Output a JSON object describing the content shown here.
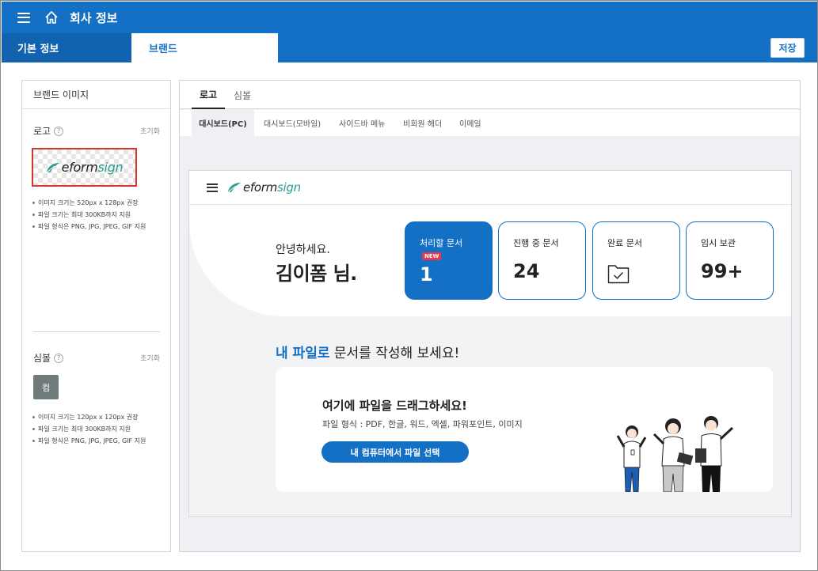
{
  "header": {
    "title": "회사 정보"
  },
  "tabs": {
    "basic": "기본 정보",
    "brand": "브랜드"
  },
  "toolbar": {
    "save_label": "저장"
  },
  "brand_image": {
    "panel_title": "브랜드 이미지",
    "logo": {
      "title": "로고",
      "reset": "초기화",
      "notes": [
        "이미지 크기는 520px x 128px 권장",
        "파일 크기는 최대 300KB까지 지원",
        "파일 형식은 PNG, JPG, JPEG, GIF 지원"
      ]
    },
    "symbol": {
      "title": "심볼",
      "reset": "초기화",
      "placeholder_char": "컴",
      "notes": [
        "이미지 크기는 120px x 120px 권장",
        "파일 크기는 최대 300KB까지 지원",
        "파일 형식은 PNG, JPG, JPEG, GIF 지원"
      ]
    }
  },
  "preview_tabs": {
    "logo": "로고",
    "symbol": "심볼"
  },
  "preview_subtabs": [
    "대시보드(PC)",
    "대시보드(모바일)",
    "사이드바 메뉴",
    "비회원 헤더",
    "이메일"
  ],
  "logo_brand": {
    "prefix": "eform",
    "suffix": "sign"
  },
  "dashboard": {
    "greeting": "안녕하세요.",
    "user": "김이폼 님.",
    "cards": [
      {
        "label": "처리할 문서",
        "badge": "NEW",
        "value": "1"
      },
      {
        "label": "진행 중 문서",
        "value": "24"
      },
      {
        "label": "완료 문서",
        "icon": "folder-check-icon"
      },
      {
        "label": "임시 보관",
        "value": "99+"
      }
    ],
    "upload_title_highlight": "내 파일로",
    "upload_title_rest": " 문서를 작성해 보세요!",
    "dropzone": {
      "title": "여기에 파일을 드래그하세요!",
      "subtitle": "파일 형식 : PDF, 한글, 워드, 엑셀, 파워포인트, 이미지",
      "button": "내 컴퓨터에서 파일 선택"
    }
  },
  "colors": {
    "primary": "#1470c4",
    "badge": "#e8384f",
    "logo_accent": "#2a9d8f"
  }
}
